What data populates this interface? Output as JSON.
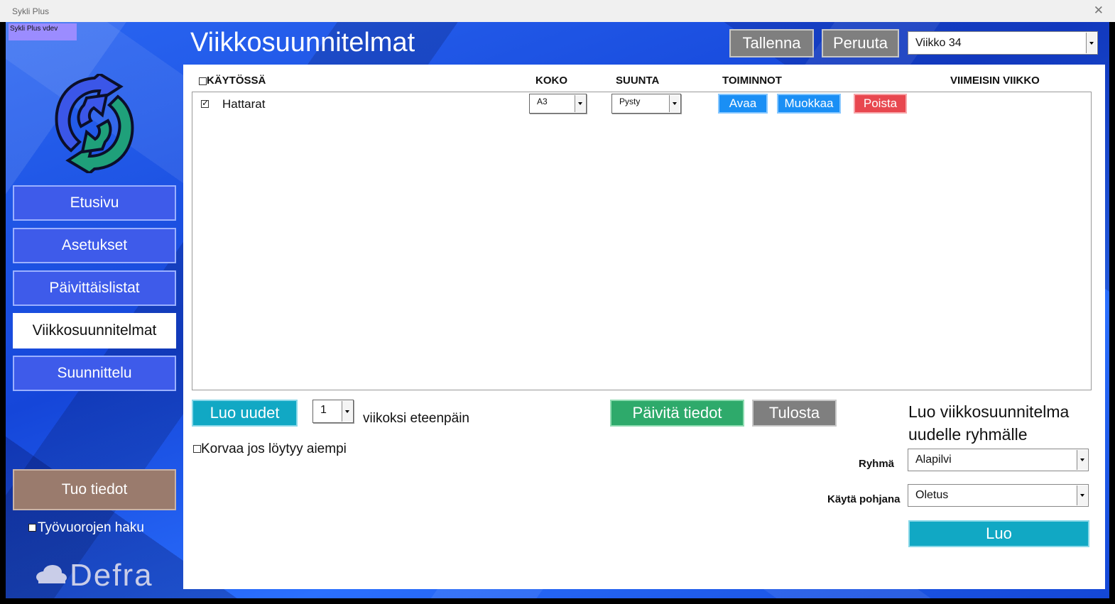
{
  "window": {
    "title": "Sykli Plus",
    "close_glyph": "✕"
  },
  "version_badge": "Sykli Plus vdev",
  "sidebar": {
    "items": [
      {
        "label": "Etusivu",
        "active": false
      },
      {
        "label": "Asetukset",
        "active": false
      },
      {
        "label": "Päivittäislistat",
        "active": false
      },
      {
        "label": "Viikkosuunnitelmat",
        "active": true
      },
      {
        "label": "Suunnittelu",
        "active": false
      }
    ],
    "import_button": "Tuo tiedot",
    "shift_fetch_label": "Työvuorojen haku",
    "brand": "Defra"
  },
  "header": {
    "title": "Viikkosuunnitelmat",
    "save_label": "Tallenna",
    "cancel_label": "Peruuta",
    "week_select": "Viikko 34"
  },
  "table": {
    "headers": {
      "in_use": "KÄYTÖSSÄ",
      "size": "KOKO",
      "direction": "SUUNTA",
      "actions": "TOIMINNOT",
      "last_week": "VIIMEISIN VIIKKO"
    },
    "rows": [
      {
        "checked": true,
        "name": "Hattarat",
        "size": "A3",
        "direction": "Pysty",
        "open": "Avaa",
        "edit": "Muokkaa",
        "delete": "Poista",
        "last_week": ""
      }
    ]
  },
  "bottom": {
    "create_new": "Luo uudet",
    "weeks_count": "1",
    "weeks_ahead_label": "viikoksi eteenpäin",
    "replace_label": "Korvaa jos löytyy aiempi",
    "refresh": "Päivitä tiedot",
    "print": "Tulosta"
  },
  "new_group": {
    "heading_line1": "Luo viikkosuunnitelma",
    "heading_line2": "uudelle ryhmälle",
    "group_label": "Ryhmä",
    "group_value": "Alapilvi",
    "template_label": "Käytä pohjana",
    "template_value": "Oletus",
    "create": "Luo"
  },
  "colors": {
    "background_blue": "#1f55e6",
    "nav_button": "#3e5bea",
    "import_button": "#9a7b6d",
    "action_blue": "#1a8ff5",
    "action_red": "#e8474f",
    "refresh_green": "#2eaa6b",
    "create_teal": "#11a8c4",
    "grey_button": "#7f7f7f"
  }
}
